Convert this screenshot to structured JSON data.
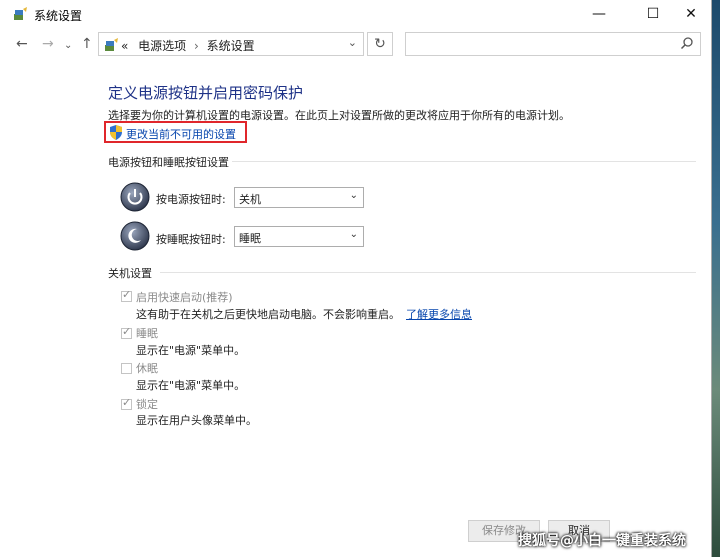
{
  "window": {
    "title": "系统设置",
    "controls": {
      "minimize": "—",
      "maximize": "☐",
      "close": "✕"
    }
  },
  "address": {
    "back": "←",
    "forward": "→",
    "recent": "⌄",
    "up": "↑",
    "prefix": "«",
    "crumbs": [
      "电源选项",
      "系统设置"
    ],
    "separator": "›",
    "dropdown": "⌄",
    "refresh": "↻",
    "search_placeholder": ""
  },
  "content": {
    "heading": "定义电源按钮并启用密码保护",
    "description": "选择要为你的计算机设置的电源设置。在此页上对设置所做的更改将应用于你所有的电源计划。",
    "change_link": "更改当前不可用的设置",
    "power_section": {
      "title": "电源按钮和睡眠按钮设置",
      "power_button": {
        "label": "按电源按钮时:",
        "value": "关机"
      },
      "sleep_button": {
        "label": "按睡眠按钮时:",
        "value": "睡眠"
      }
    },
    "shutdown_section": {
      "title": "关机设置",
      "items": [
        {
          "label": "启用快速启动(推荐)",
          "checked": true,
          "desc": "这有助于在关机之后更快地启动电脑。不会影响重启。",
          "link": "了解更多信息"
        },
        {
          "label": "睡眠",
          "checked": true,
          "desc": "显示在\"电源\"菜单中。"
        },
        {
          "label": "休眠",
          "checked": false,
          "desc": "显示在\"电源\"菜单中。"
        },
        {
          "label": "锁定",
          "checked": true,
          "desc": "显示在用户头像菜单中。"
        }
      ]
    }
  },
  "footer": {
    "save": "保存修改",
    "cancel": "取消"
  },
  "watermark": "搜狐号@小白一键重装系统",
  "colors": {
    "heading": "#1e3287",
    "link": "#0645ad",
    "highlight_border": "#e0262b"
  }
}
